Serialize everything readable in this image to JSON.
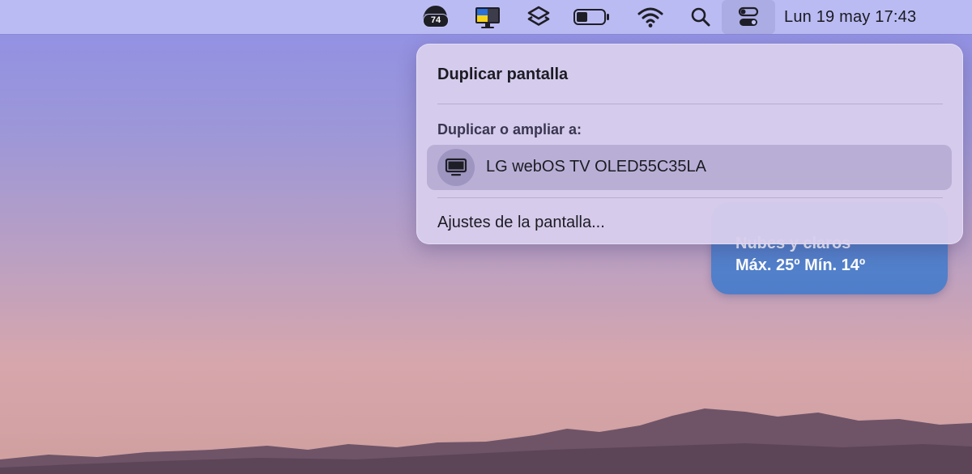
{
  "menubar": {
    "notification_badge": "74",
    "icons": [
      "app-badge-icon",
      "display-flag-icon",
      "shortcuts-icon",
      "battery-icon",
      "wifi-icon",
      "search-icon",
      "control-center-icon"
    ],
    "clock": "Lun 19 may 17:43"
  },
  "mirror_panel": {
    "title": "Duplicar pantalla",
    "section_label": "Duplicar o ampliar a:",
    "devices": [
      {
        "name": "LG webOS TV OLED55C35LA",
        "icon": "tv-icon"
      }
    ],
    "settings_link": "Ajustes de la pantalla..."
  },
  "weather_widget": {
    "condition_partial": "Nubes y claros",
    "temps": "Máx. 25º Mín. 14º"
  },
  "colors": {
    "menubar": "#c4c4f6",
    "panel": "#d7cdec",
    "device_row": "#8c82b4",
    "weather": "#5a85cf",
    "mountain": "#6f5468"
  }
}
